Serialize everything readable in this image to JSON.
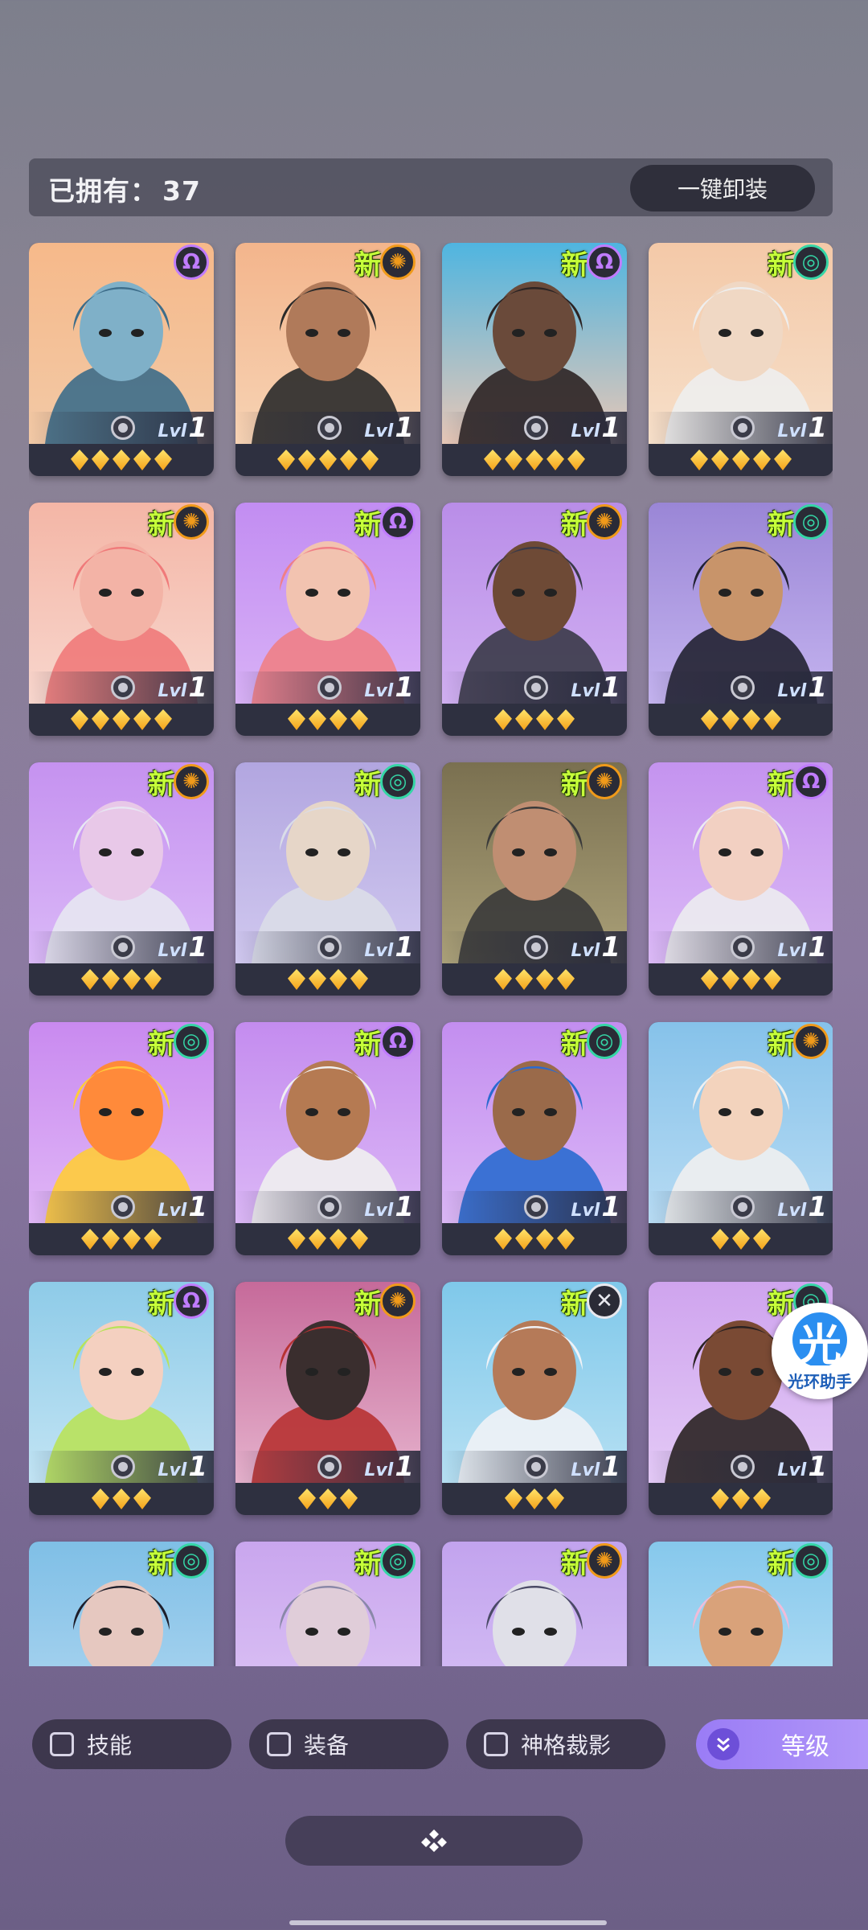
{
  "header": {
    "owned_label": "已拥有：",
    "owned_count": "37",
    "unequip_all": "一键卸装"
  },
  "colors": {
    "new_badge": "#c6ff3a",
    "star": "#f4a21a",
    "card_bg": "#2e3040",
    "accent": "#9a7cf6",
    "elem_orange": "#f09a1a",
    "elem_green": "#35d6a6",
    "elem_purple": "#c07cff",
    "elem_white": "#e8e8ee"
  },
  "cards": [
    {
      "new": "",
      "element": "omega-icon",
      "level_text": "Lvl",
      "level": "1",
      "stars": 5
    },
    {
      "new": "新",
      "element": "sun-icon",
      "level_text": "Lvl",
      "level": "1",
      "stars": 5
    },
    {
      "new": "新",
      "element": "omega-icon",
      "level_text": "Lvl",
      "level": "1",
      "stars": 5
    },
    {
      "new": "新",
      "element": "spiral-icon",
      "level_text": "Lvl",
      "level": "1",
      "stars": 5
    },
    {
      "new": "新",
      "element": "sun-icon",
      "level_text": "Lvl",
      "level": "1",
      "stars": 5
    },
    {
      "new": "新",
      "element": "omega-icon",
      "level_text": "Lvl",
      "level": "1",
      "stars": 4
    },
    {
      "new": "新",
      "element": "sun-icon",
      "level_text": "Lvl",
      "level": "1",
      "stars": 4
    },
    {
      "new": "新",
      "element": "spiral-icon",
      "level_text": "Lvl",
      "level": "1",
      "stars": 4
    },
    {
      "new": "新",
      "element": "sun-icon",
      "level_text": "Lvl",
      "level": "1",
      "stars": 4
    },
    {
      "new": "新",
      "element": "spiral-icon",
      "level_text": "Lvl",
      "level": "1",
      "stars": 4
    },
    {
      "new": "新",
      "element": "sun-icon",
      "level_text": "Lvl",
      "level": "1",
      "stars": 4
    },
    {
      "new": "新",
      "element": "omega-icon",
      "level_text": "Lvl",
      "level": "1",
      "stars": 4
    },
    {
      "new": "新",
      "element": "spiral-icon",
      "level_text": "Lvl",
      "level": "1",
      "stars": 4
    },
    {
      "new": "新",
      "element": "omega-icon",
      "level_text": "Lvl",
      "level": "1",
      "stars": 4
    },
    {
      "new": "新",
      "element": "spiral-icon",
      "level_text": "Lvl",
      "level": "1",
      "stars": 4
    },
    {
      "new": "新",
      "element": "sun-icon",
      "level_text": "Lvl",
      "level": "1",
      "stars": 3
    },
    {
      "new": "新",
      "element": "omega-icon",
      "level_text": "Lvl",
      "level": "1",
      "stars": 3
    },
    {
      "new": "新",
      "element": "sun-icon",
      "level_text": "Lvl",
      "level": "1",
      "stars": 3
    },
    {
      "new": "新",
      "element": "cross-icon",
      "level_text": "Lvl",
      "level": "1",
      "stars": 3
    },
    {
      "new": "新",
      "element": "spiral-icon",
      "level_text": "Lvl",
      "level": "1",
      "stars": 3
    },
    {
      "new": "新",
      "element": "spiral-icon",
      "level_text": "",
      "level": "",
      "stars": 0
    },
    {
      "new": "新",
      "element": "spiral-icon",
      "level_text": "",
      "level": "",
      "stars": 0
    },
    {
      "new": "新",
      "element": "sun-icon",
      "level_text": "",
      "level": "",
      "stars": 0
    },
    {
      "new": "新",
      "element": "spiral-icon",
      "level_text": "",
      "level": "",
      "stars": 0
    }
  ],
  "filters": {
    "skill": "技能",
    "equipment": "装备",
    "god_shadow": "神格裁影",
    "sort_label": "等级"
  },
  "assistant": {
    "glyph": "光",
    "label": "光环助手"
  }
}
